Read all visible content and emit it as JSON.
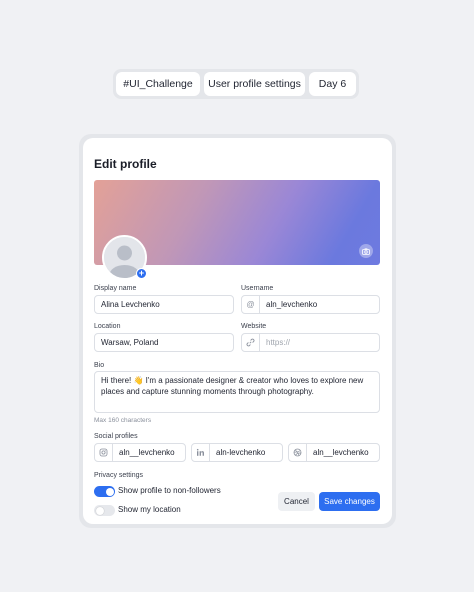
{
  "tags": [
    "#UI_Challenge",
    "User profile settings",
    "Day 6"
  ],
  "card": {
    "title": "Edit profile",
    "display_name": {
      "label": "Display name",
      "value": "Alina Levchenko"
    },
    "username": {
      "label": "Username",
      "prefix": "@",
      "value": "aln_levchenko"
    },
    "location": {
      "label": "Location",
      "value": "Warsaw, Poland"
    },
    "website": {
      "label": "Website",
      "placeholder": "https://"
    },
    "bio": {
      "label": "Bio",
      "value": "Hi there! 👋 I'm a passionate designer & creator who loves to explore new places and capture stunning moments through photography.",
      "hint": "Max 160 characters"
    },
    "social": {
      "label": "Social profiles",
      "instagram": "aln__levchenko",
      "linkedin": "aln-levchenko",
      "dribbble": "aln__levchenko"
    },
    "privacy": {
      "label": "Privacy settings",
      "show_profile": {
        "label": "Show profile to non-followers",
        "on": true
      },
      "show_location": {
        "label": "Show my location",
        "on": false
      }
    },
    "actions": {
      "cancel": "Cancel",
      "save": "Save changes"
    }
  },
  "colors": {
    "accent": "#2d6ef0",
    "background": "#f0f1f4"
  }
}
